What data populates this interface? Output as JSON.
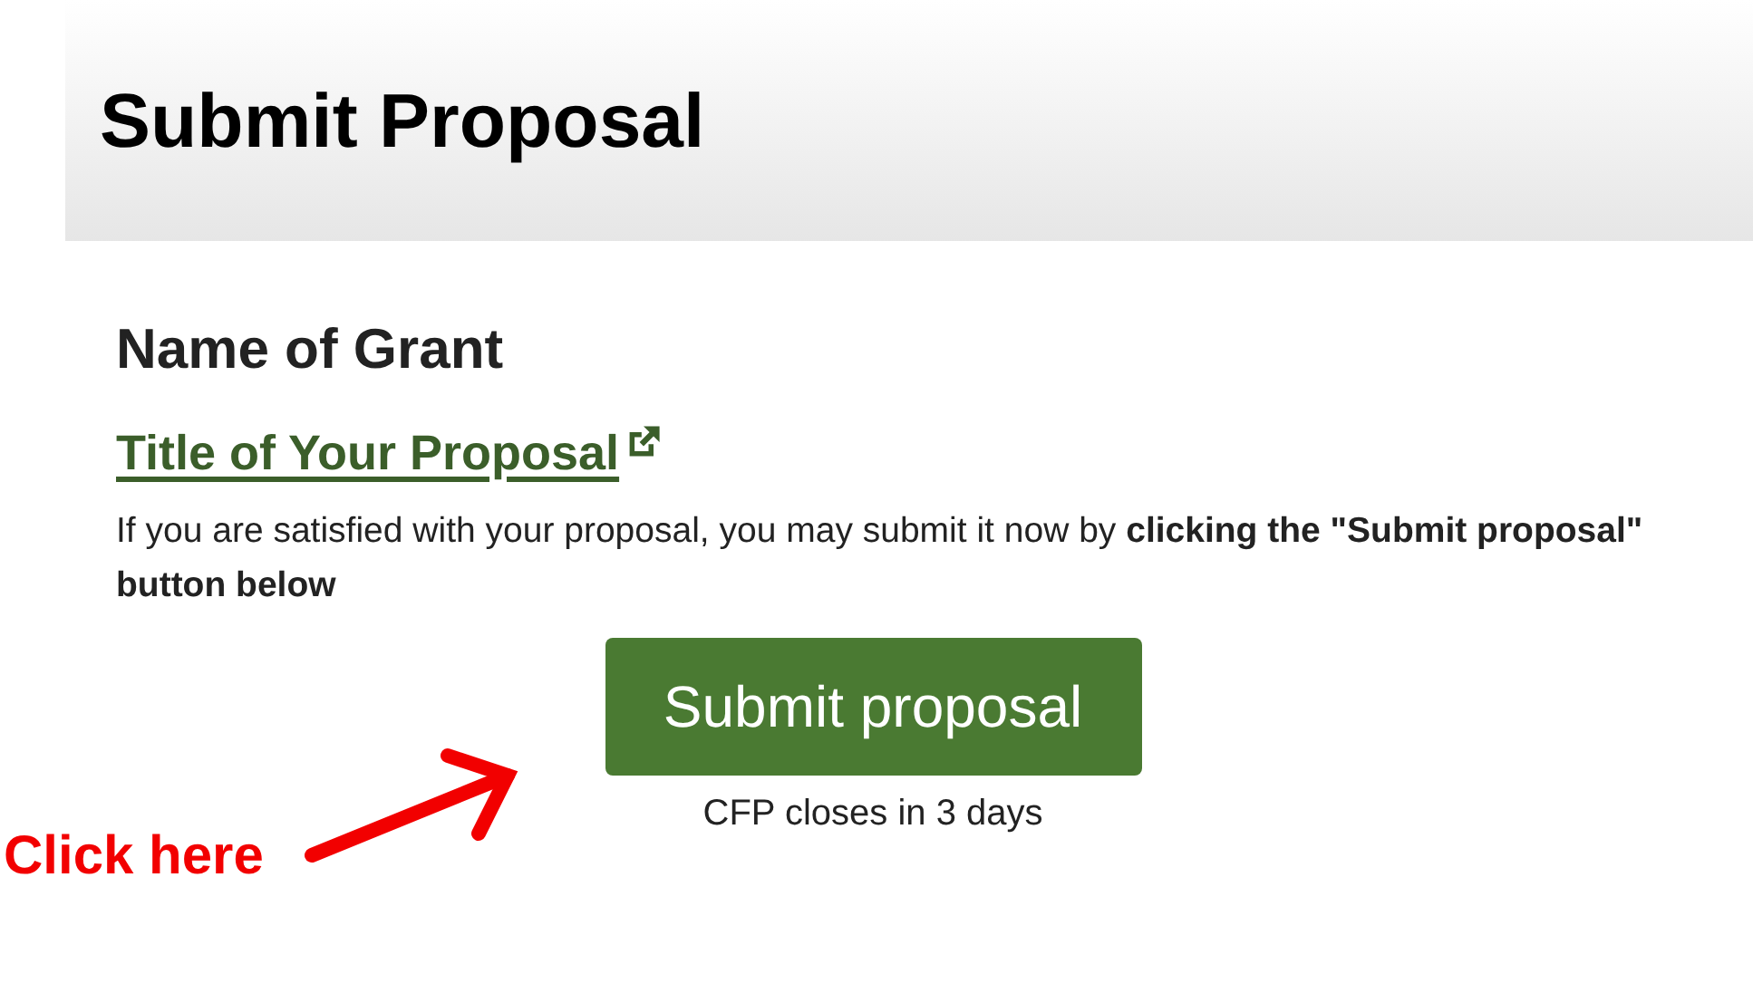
{
  "header": {
    "title": "Submit Proposal"
  },
  "grant_name": "Name of Grant",
  "proposal_link": "Title of Your Proposal",
  "instructions": "If you are satisfied with your proposal, you may submit it now by **clicking the \"Submit proposal\" button below**",
  "submit_button": "Submit proposal",
  "deadline_note": "CFP closes in 3 days",
  "annotation": {
    "label": "Click here"
  }
}
